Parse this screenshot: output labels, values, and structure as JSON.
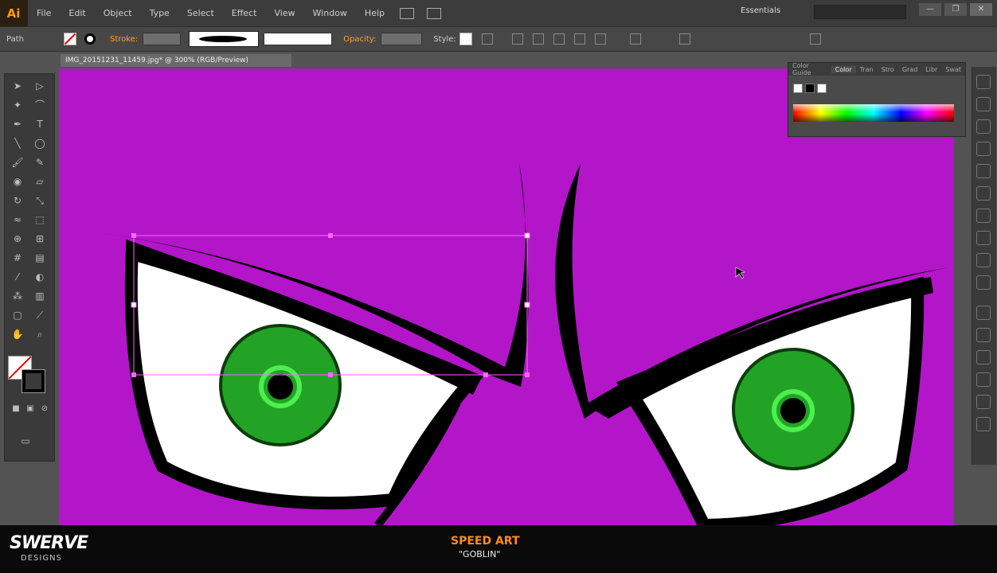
{
  "app": {
    "logo": "Ai",
    "menu": [
      "File",
      "Edit",
      "Object",
      "Type",
      "Select",
      "Effect",
      "View",
      "Window",
      "Help"
    ],
    "workspace": "Essentials",
    "window_buttons": [
      "—",
      "❐",
      "✕"
    ]
  },
  "control_bar": {
    "selection_label": "Path",
    "stroke_label": "Stroke:",
    "opacity_label": "Opacity:",
    "style_label": "Style:"
  },
  "document": {
    "tab_title": "IMG_20151231_11459.jpg* @ 300% (RGB/Preview)"
  },
  "color_panel": {
    "tabs": [
      "Color Guide",
      "Color",
      "Tran",
      "Stro",
      "Grad",
      "Libr",
      "Swat"
    ],
    "active_tab": "Color"
  },
  "colors": {
    "canvas": "#b315c9",
    "iris": "#22a326",
    "iris_ring": "#4cf04c",
    "eye_white": "#ffffff",
    "outline": "#000000",
    "accent": "#ff8c1a",
    "anchor": "#ff66ff"
  },
  "footer": {
    "brand": "SWERVE",
    "brand_sub": "DESIGNS",
    "title": "SPEED ART",
    "subtitle": "\"GOBLIN\""
  },
  "icons": {
    "tools": [
      "selection-icon",
      "direct-selection-icon",
      "magic-wand-icon",
      "lasso-icon",
      "pen-icon",
      "type-icon",
      "line-icon",
      "ellipse-icon",
      "paintbrush-icon",
      "pencil-icon",
      "blob-brush-icon",
      "eraser-icon",
      "rotate-icon",
      "scale-icon",
      "warp-icon",
      "free-transform-icon",
      "shape-builder-icon",
      "perspective-icon",
      "mesh-icon",
      "gradient-icon",
      "eyedropper-icon",
      "blend-icon",
      "symbol-sprayer-icon",
      "graph-icon",
      "artboard-icon",
      "slice-icon",
      "hand-icon",
      "zoom-icon"
    ],
    "right_panel": [
      "color-panel-icon",
      "color-guide-icon",
      "swatches-icon",
      "brushes-icon",
      "symbols-icon",
      "graphic-styles-icon",
      "stroke-icon",
      "gradient-panel-icon",
      "transparency-icon",
      "appearance-icon",
      "layers-icon",
      "artboards-icon",
      "align-icon",
      "pathfinder-icon",
      "transform-icon",
      "links-icon"
    ]
  }
}
